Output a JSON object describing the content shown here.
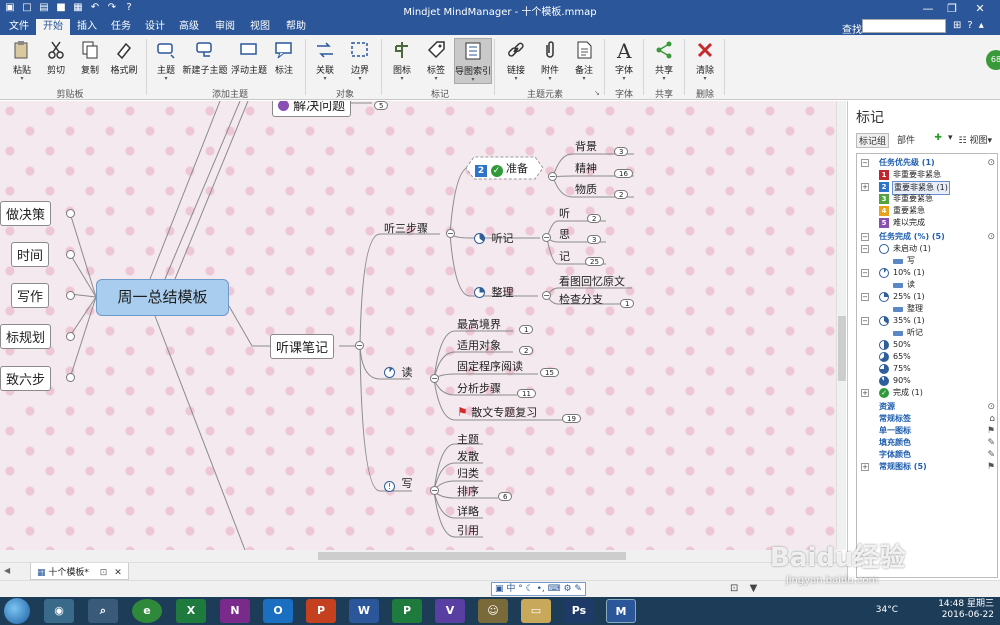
{
  "window": {
    "title": "Mindjet MindManager - 十个模板.mmap"
  },
  "menu": {
    "tabs": [
      "文件",
      "开始",
      "插入",
      "任务",
      "设计",
      "高级",
      "审阅",
      "视图",
      "帮助"
    ],
    "active": "开始",
    "search_label": "查找:",
    "search_value": ""
  },
  "ribbon": {
    "buttons": [
      "粘贴",
      "剪切",
      "复制",
      "格式刷",
      "主题",
      "新建子主题",
      "浮动主题",
      "标注",
      "关联",
      "边界",
      "图标",
      "标签",
      "导图索引",
      "链接",
      "附件",
      "备注",
      "字体",
      "共享",
      "清除"
    ],
    "groups": [
      "剪贴板",
      "添加主题",
      "对象",
      "标记",
      "主题元素",
      "字体",
      "共享",
      "删除"
    ]
  },
  "map": {
    "central": "周一总结模板",
    "left_topics": [
      "做决策",
      "时间",
      "写作",
      "标规划",
      "致六步"
    ],
    "top_topic": "解决问题",
    "top_topic_count": "5",
    "main_topic": "听课笔记",
    "branch_listen": "听三步骤",
    "prepare": {
      "label": "准备",
      "priority": "2",
      "children": [
        "背景",
        "精神",
        "物质"
      ],
      "counts": [
        "3",
        "16",
        "2"
      ]
    },
    "listen_note": {
      "label": "听记",
      "children": [
        "听",
        "思",
        "记"
      ],
      "counts": [
        "2",
        "3",
        "25"
      ]
    },
    "organize": {
      "label": "整理",
      "children": [
        "看图回忆原文",
        "检查分支"
      ],
      "counts": [
        "1"
      ]
    },
    "read": {
      "label": "读",
      "children": [
        "最高境界",
        "适用对象",
        "固定程序阅读",
        "分析步骤",
        "散文专题复习"
      ],
      "counts": [
        "1",
        "2",
        "15",
        "11",
        "19"
      ]
    },
    "write": {
      "label": "写",
      "children": [
        "主题",
        "发散",
        "归类",
        "排序",
        "详略",
        "引用"
      ],
      "count": "6"
    }
  },
  "panel": {
    "title": "标记",
    "tabs": [
      "标记组",
      "部件"
    ],
    "view_label": "视图",
    "groups": {
      "priority": {
        "label": "任务优先级 (1)",
        "items": [
          "非重要非紧急",
          "重要非紧急 (1)",
          "非重要紧急",
          "重要紧急",
          "难以完成"
        ],
        "numbers": [
          "1",
          "2",
          "3",
          "4",
          "5"
        ],
        "colors": [
          "#c0262d",
          "#2e75c9",
          "#54a33f",
          "#e8a21b",
          "#8a4fb3"
        ]
      },
      "completion": {
        "label": "任务完成 (%) (5)",
        "items": [
          "未启动 (1)",
          "写",
          "10% (1)",
          "读",
          "25% (1)",
          "整理",
          "35% (1)",
          "听记",
          "50%",
          "65%",
          "75%",
          "90%",
          "完成 (1)"
        ]
      },
      "others": [
        "资源",
        "常规标签",
        "单一图标",
        "填充颜色",
        "字体颜色",
        "常规图标 (5)"
      ]
    }
  },
  "doc_tab": "十个模板*",
  "status": {
    "language": "中"
  },
  "taskbar": {
    "apps": [
      "X",
      "N",
      "O",
      "P",
      "W",
      "P",
      "V",
      "Ps",
      "M"
    ],
    "app_colors": [
      "#1f7a3d",
      "#7a2a8a",
      "#1a6fc0",
      "#c4401f",
      "#2b579a",
      "#1f7a3d",
      "#5a3fa3",
      "#1d3b66",
      "#2b579a"
    ],
    "temperature": "34°C",
    "time": "14:48 星期三",
    "date": "2016-06-22"
  },
  "watermark": {
    "logo": "Baidu经验",
    "url": "jingyan.baidu.com"
  }
}
